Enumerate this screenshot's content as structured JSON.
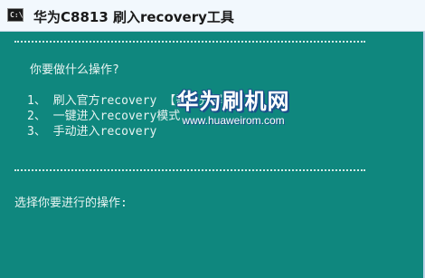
{
  "window": {
    "title": "华为C8813 刷入recovery工具",
    "icon_label": "C:\\"
  },
  "console": {
    "separator_top": "================================================",
    "prompt_question": "你要做什么操作?",
    "options": [
      "1、 刷入官方recovery 【需要先解锁】",
      "2、 一键进入recovery模式",
      "3、 手动进入recovery"
    ],
    "separator_bottom": "================================================",
    "input_prompt": "选择你要进行的操作:"
  },
  "watermark": {
    "brand": "华为刷机网",
    "url": "www.huaweirom.com"
  },
  "colors": {
    "console_bg": "#0f877e",
    "console_text": "#e8f4f2",
    "titlebar_bg": "#f2f8fd"
  }
}
